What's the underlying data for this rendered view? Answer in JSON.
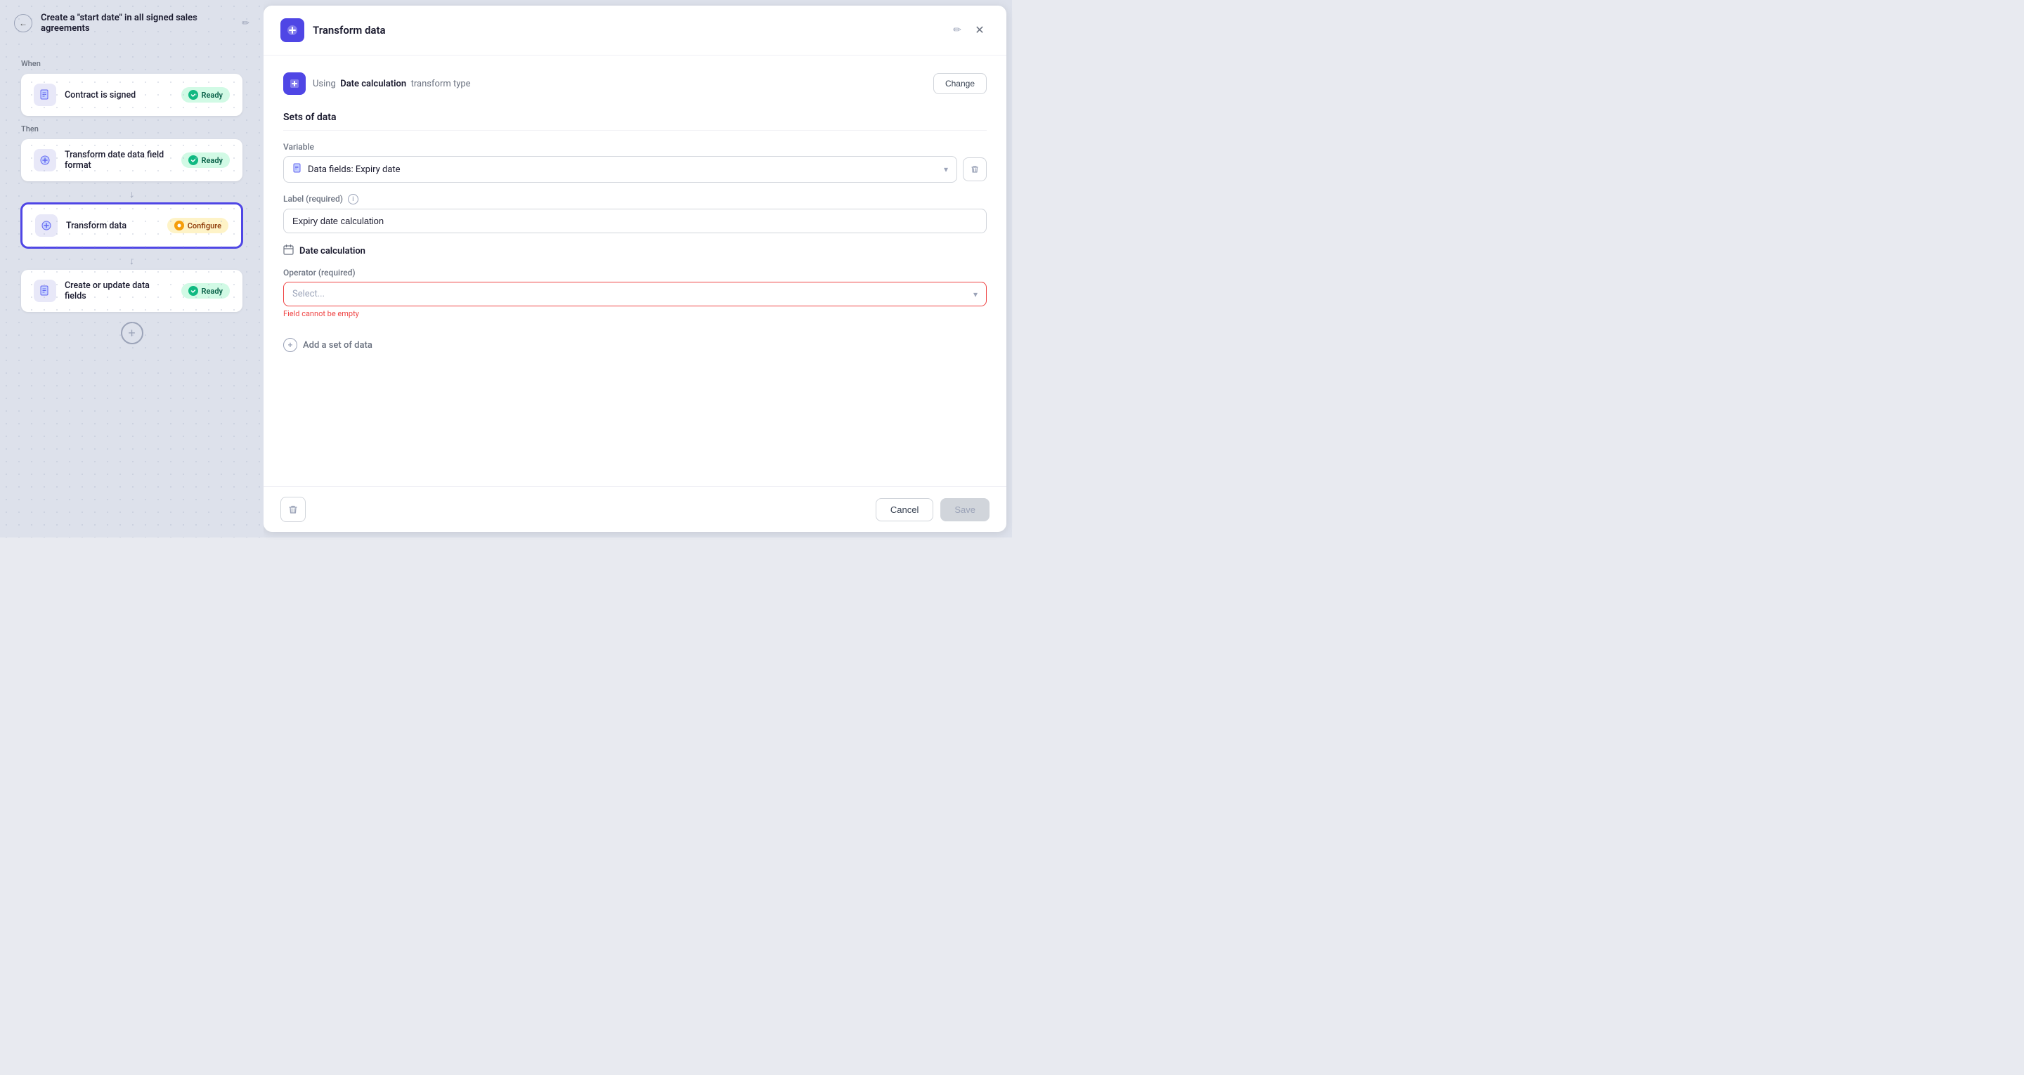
{
  "header": {
    "back_label": "←",
    "title": "Create a \"start date\" in all signed sales agreements",
    "edit_icon": "✏"
  },
  "left": {
    "when_label": "When",
    "then_label": "Then",
    "steps": [
      {
        "id": "contract-signed",
        "label": "Contract is signed",
        "status": "Ready",
        "status_type": "ready",
        "icon_type": "doc"
      },
      {
        "id": "transform-date",
        "label": "Transform date data field format",
        "status": "Ready",
        "status_type": "ready",
        "icon_type": "star"
      },
      {
        "id": "transform-data",
        "label": "Transform data",
        "status": "Configure",
        "status_type": "configure",
        "icon_type": "star",
        "active": true
      },
      {
        "id": "create-update",
        "label": "Create or update data fields",
        "status": "Ready",
        "status_type": "ready",
        "icon_type": "doc"
      }
    ],
    "add_step_label": "+"
  },
  "right": {
    "title": "Transform data",
    "edit_icon": "✏",
    "close_icon": "✕",
    "transform_type": {
      "prefix": "Using",
      "type_name": "Date calculation",
      "suffix": "transform type",
      "change_label": "Change"
    },
    "sets_of_data_label": "Sets of data",
    "variable_label": "Variable",
    "variable_value": "Data fields: Expiry date",
    "label_required": "Label (required)",
    "label_value": "Expiry date calculation",
    "date_calc_label": "Date calculation",
    "operator_label": "Operator (required)",
    "operator_placeholder": "Select...",
    "operator_error": "Field cannot be empty",
    "add_set_label": "Add a set of data",
    "footer": {
      "cancel_label": "Cancel",
      "save_label": "Save"
    }
  }
}
